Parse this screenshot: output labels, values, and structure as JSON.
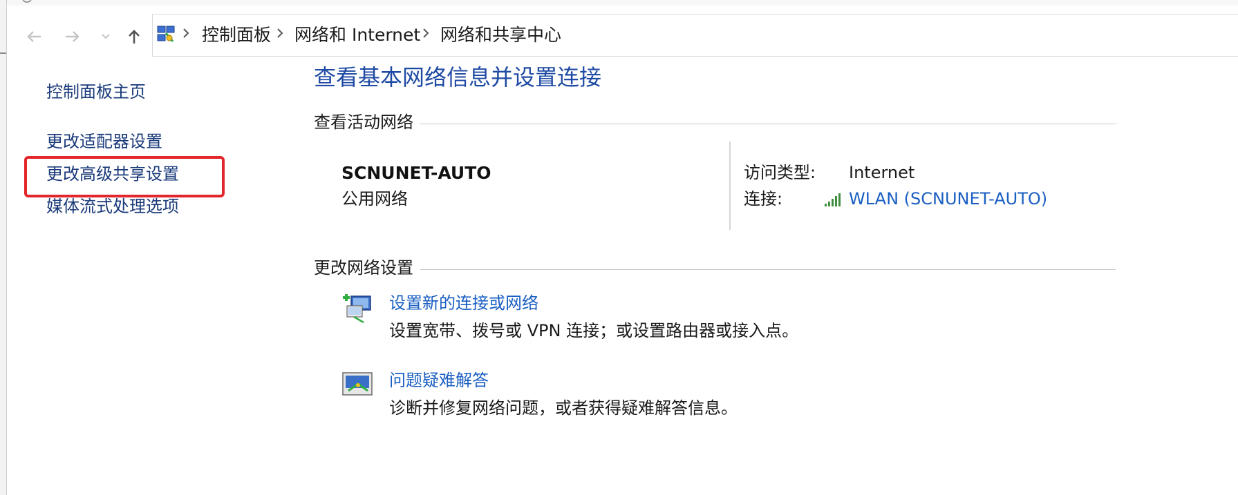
{
  "breadcrumb": {
    "items": [
      "控制面板",
      "网络和 Internet",
      "网络和共享中心"
    ]
  },
  "sidebar": {
    "items": [
      {
        "label": "控制面板主页"
      },
      {
        "label": "更改适配器设置"
      },
      {
        "label": "更改高级共享设置",
        "highlighted": true
      },
      {
        "label": "媒体流式处理选项"
      }
    ]
  },
  "main": {
    "title": "查看基本网络信息并设置连接",
    "active_networks": {
      "heading": "查看活动网络",
      "network_name": "SCNUNET-AUTO",
      "network_type": "公用网络",
      "access_type_label": "访问类型:",
      "access_type_value": "Internet",
      "connection_label": "连接:",
      "connection_value": "WLAN (SCNUNET-AUTO)"
    },
    "change_settings": {
      "heading": "更改网络设置",
      "tasks": [
        {
          "icon": "new-connection-icon",
          "title": "设置新的连接或网络",
          "description": "设置宽带、拨号或 VPN 连接；或设置路由器或接入点。"
        },
        {
          "icon": "troubleshoot-icon",
          "title": "问题疑难解答",
          "description": "诊断并修复网络问题，或者获得疑难解答信息。"
        }
      ]
    }
  },
  "colors": {
    "link": "#1a5fc2",
    "title": "#1e4aa3",
    "highlight": "#e3262b"
  }
}
